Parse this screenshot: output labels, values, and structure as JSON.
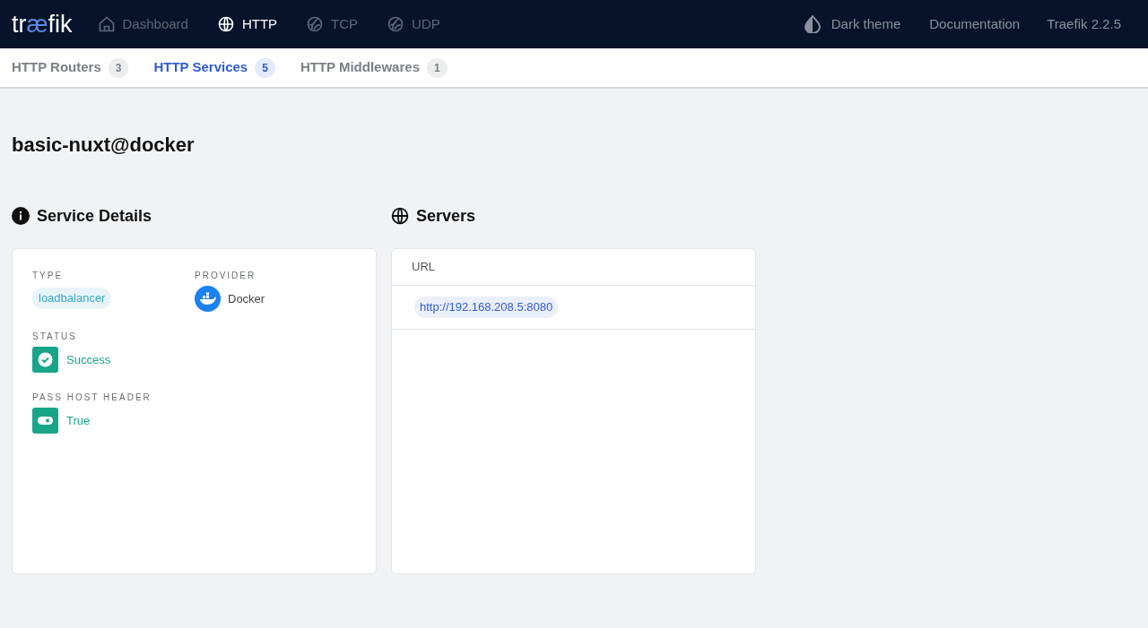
{
  "logo": {
    "parts": [
      {
        "text": "tr",
        "accent": false
      },
      {
        "text": "æ",
        "accent": true
      },
      {
        "text": "fik",
        "accent": false
      }
    ]
  },
  "nav": [
    {
      "label": "Dashboard",
      "kind": "home",
      "selected": false
    },
    {
      "label": "HTTP",
      "kind": "globe",
      "selected": true
    },
    {
      "label": "TCP",
      "kind": "ball",
      "selected": false
    },
    {
      "label": "UDP",
      "kind": "ball",
      "selected": false
    }
  ],
  "nav_right": {
    "theme": "Dark theme",
    "docs": "Documentation",
    "version": "Traefik 2.2.5"
  },
  "tabs": [
    {
      "label": "HTTP Routers",
      "count": "3",
      "selected": false
    },
    {
      "label": "HTTP Services",
      "count": "5",
      "selected": true
    },
    {
      "label": "HTTP Middlewares",
      "count": "1",
      "selected": false
    }
  ],
  "title": "basic-nuxt@docker",
  "details": {
    "heading": "Service Details",
    "type_label": "TYPE",
    "type": "loadbalancer",
    "provider_label": "PROVIDER",
    "provider": "Docker",
    "status_label": "STATUS",
    "status": "Success",
    "pass_label": "PASS HOST HEADER",
    "pass": "True"
  },
  "servers": {
    "heading": "Servers",
    "column": "URL",
    "rows": [
      "http://192.168.208.5:8080"
    ]
  }
}
